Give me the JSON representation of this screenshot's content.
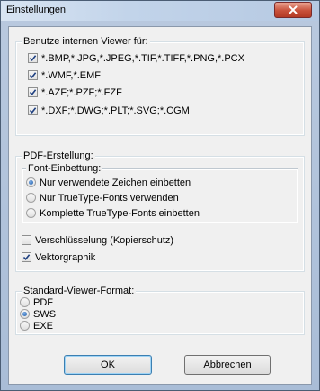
{
  "window": {
    "title": "Einstellungen"
  },
  "viewer_group": {
    "label": "Benutze internen Viewer für:",
    "items": [
      {
        "label": "*.BMP,*.JPG,*.JPEG,*.TIF,*.TIFF,*.PNG,*.PCX",
        "checked": true
      },
      {
        "label": "*.WMF,*.EMF",
        "checked": true
      },
      {
        "label": "*.AZF;*.PZF;*.FZF",
        "checked": true
      },
      {
        "label": "*.DXF;*.DWG;*.PLT;*.SVG;*.CGM",
        "checked": true
      }
    ]
  },
  "pdf_group": {
    "label": "PDF-Erstellung:",
    "font_group": {
      "label": "Font-Einbettung:",
      "options": [
        {
          "label": "Nur verwendete Zeichen einbetten",
          "selected": true
        },
        {
          "label": "Nur TrueType-Fonts verwenden",
          "selected": false
        },
        {
          "label": "Komplette TrueType-Fonts einbetten",
          "selected": false
        }
      ]
    },
    "encryption": {
      "label": "Verschlüsselung (Kopierschutz)",
      "checked": false
    },
    "vector": {
      "label": "Vektorgraphik",
      "checked": true
    }
  },
  "format_group": {
    "label": "Standard-Viewer-Format:",
    "options": [
      {
        "label": "PDF",
        "selected": false
      },
      {
        "label": "SWS",
        "selected": true
      },
      {
        "label": "EXE",
        "selected": false
      }
    ]
  },
  "buttons": {
    "ok": "OK",
    "cancel": "Abbrechen"
  }
}
